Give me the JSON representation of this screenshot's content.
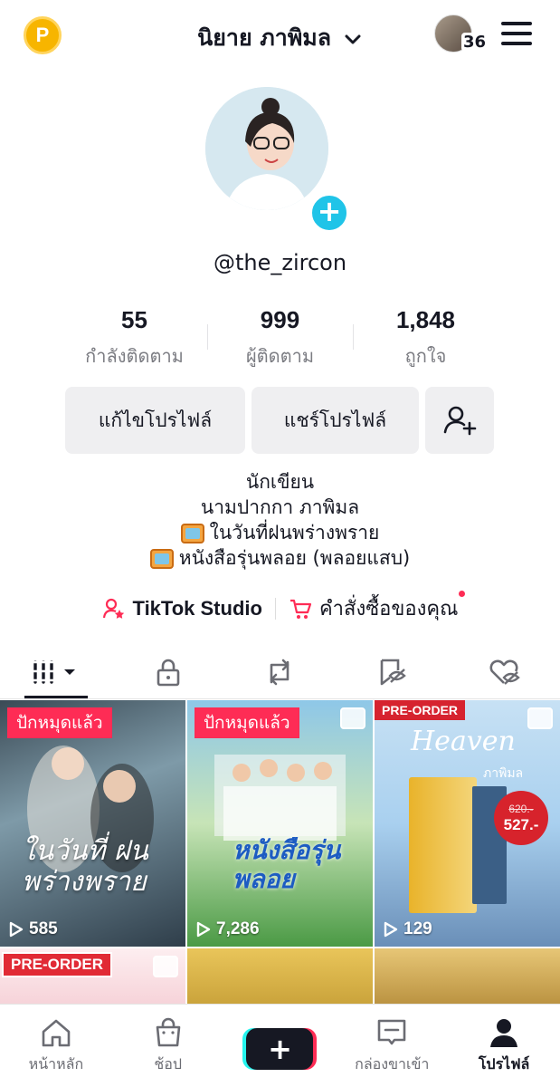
{
  "header": {
    "title": "นิยาย ภาพิมล",
    "coin_label": "P",
    "notification_count": "36"
  },
  "profile": {
    "username": "@the_zircon"
  },
  "stats": [
    {
      "value": "55",
      "label": "กำลังติดตาม"
    },
    {
      "value": "999",
      "label": "ผู้ติดตาม"
    },
    {
      "value": "1,848",
      "label": "ถูกใจ"
    }
  ],
  "buttons": {
    "edit": "แก้ไขโปรไฟล์",
    "share": "แชร์โปรไฟล์"
  },
  "bio": {
    "line1": "นักเขียน",
    "line2": "นามปากกา ภาพิมล",
    "line3": "ในวันที่ฝนพร่างพราย",
    "line4": "หนังสือรุ่นพลอย (พลอยแสบ)"
  },
  "links": {
    "studio": "TikTok Studio",
    "orders": "คำสั่งซื้อของคุณ"
  },
  "videos": [
    {
      "badge": "ปักหมุดแล้ว",
      "views": "585",
      "title": "ในวันที่ ฝนพร่างพราย"
    },
    {
      "badge": "ปักหมุดแล้ว",
      "views": "7,286",
      "title": "หนังสือรุ่น พลอย"
    },
    {
      "badge": "PRE-ORDER",
      "views": "129",
      "title": "Heaven",
      "author": "ภาพิมล",
      "old_price": "620.-",
      "new_price": "527.-"
    },
    {
      "badge": "PRE-ORDER"
    },
    {},
    {}
  ],
  "bottom_nav": [
    {
      "label": "หน้าหลัก",
      "icon": "home-icon"
    },
    {
      "label": "ช้อป",
      "icon": "shop-bag-icon"
    },
    {
      "label": "",
      "icon": "create-plus-icon"
    },
    {
      "label": "กล่องขาเข้า",
      "icon": "inbox-icon"
    },
    {
      "label": "โปรไฟล์",
      "icon": "profile-icon"
    }
  ],
  "colors": {
    "accent": "#fe2c55",
    "cyan": "#25f4ee",
    "badge_blue": "#20c4e8"
  }
}
